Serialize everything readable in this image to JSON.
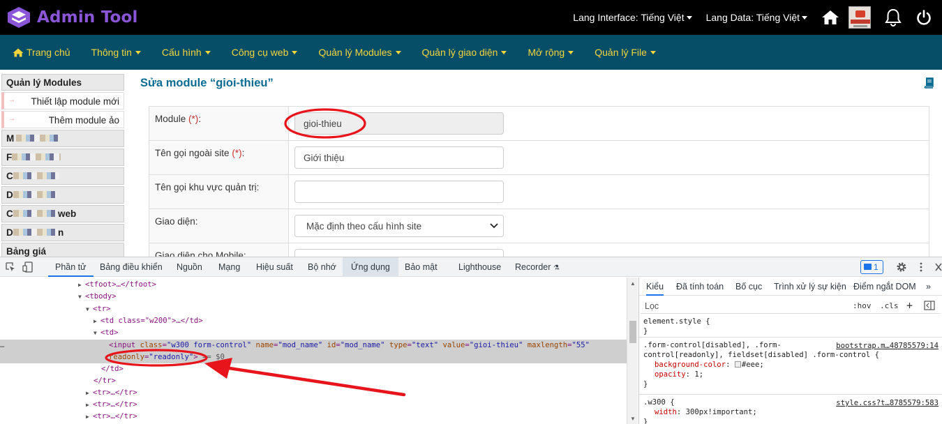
{
  "app": {
    "logo_text": "Admin Tool",
    "lang_interface": "Lang Interface: Tiếng Việt",
    "lang_data": "Lang Data: Tiếng Việt"
  },
  "nav": {
    "home": "Trang chủ",
    "items": [
      "Thông tin",
      "Cấu hình",
      "Công cụ web",
      "Quản lý Modules",
      "Quản lý giao diện",
      "Mở rộng",
      "Quản lý File"
    ]
  },
  "sidebar": {
    "header": "Quản lý Modules",
    "sub_items": [
      "Thiết lập module mới",
      "Thêm module ảo"
    ],
    "items": [
      "M",
      "F",
      "C",
      "D",
      "C",
      "D",
      "Bảng giá"
    ],
    "item5_suffix": "web",
    "item6_suffix": "n"
  },
  "page": {
    "title": "Sửa module “gioi-thieu”"
  },
  "form": {
    "module_label": "Module",
    "module_value": "gioi-thieu",
    "site_name_label": "Tên gọi ngoài site",
    "site_name_value": "Giới thiệu",
    "admin_name_label": "Tên gọi khu vực quản trị:",
    "admin_name_value": "",
    "theme_label": "Giao diện:",
    "theme_value": "Mặc định theo cấu hình site",
    "mobile_theme_label": "Giao diện cho Mobile:",
    "required_mark": "(*)",
    "colon": ":"
  },
  "devtools": {
    "tabs": [
      "Phần tử",
      "Bảng điều khiển",
      "Nguồn",
      "Mạng",
      "Hiệu suất",
      "Bộ nhớ",
      "Ứng dụng",
      "Bảo mật",
      "Lighthouse",
      "Recorder"
    ],
    "issues_count": "1",
    "dom": {
      "tfoot": "<tfoot>…</tfoot>",
      "tbody": "<tbody>",
      "tr": "<tr>",
      "td_w200": "<td class=\"w200\">…</td>",
      "td": "<td>",
      "input_tag_open": "<input",
      "attr_class": "class",
      "attr_class_val": "\"w300 form-control\"",
      "attr_name": "name",
      "attr_name_val": "\"mod_name\"",
      "attr_id": "id",
      "attr_id_val": "\"mod_name\"",
      "attr_type": "type",
      "attr_type_val": "\"text\"",
      "attr_value": "value",
      "attr_value_val": "\"gioi-thieu\"",
      "attr_maxlength": "maxlength",
      "attr_maxlength_val": "\"55\"",
      "attr_readonly": "readonly",
      "attr_readonly_val": "\"readonly\"",
      "input_tag_close": ">",
      "eq": "== $0",
      "td_close": "</td>",
      "tr_close": "</tr>",
      "tr_collapsed": "<tr>…</tr>",
      "ellipsis": "…"
    },
    "styles_tabs": [
      "Kiểu",
      "Đã tính toán",
      "Bố cục",
      "Trình xử lý sự kiện",
      "Điểm ngắt DOM"
    ],
    "filter_placeholder": "Lọc",
    "hov": ":hov",
    "cls": ".cls",
    "rules": {
      "element_style": "element.style {",
      "brace_close": "}",
      "fc_selector_1": ".form-control[disabled], .form-",
      "fc_selector_2": "control[readonly], fieldset[disabled] .form-control {",
      "fc_source": "bootstrap.m…48785579:14",
      "fc_prop1": "background-color",
      "fc_val1": "#eee;",
      "fc_prop2": "opacity",
      "fc_val2": "1;",
      "w300_selector": ".w300 {",
      "w300_source": "style.css?t…8785579:583",
      "w300_prop": "width",
      "w300_val": "300px!important;"
    }
  },
  "colors": {
    "topbar": "#000000",
    "logo": "#8a55d6",
    "navbar": "#064e68",
    "nav_text": "#f1d53b",
    "title": "#0b6c93",
    "annotation": "#e8141b"
  }
}
